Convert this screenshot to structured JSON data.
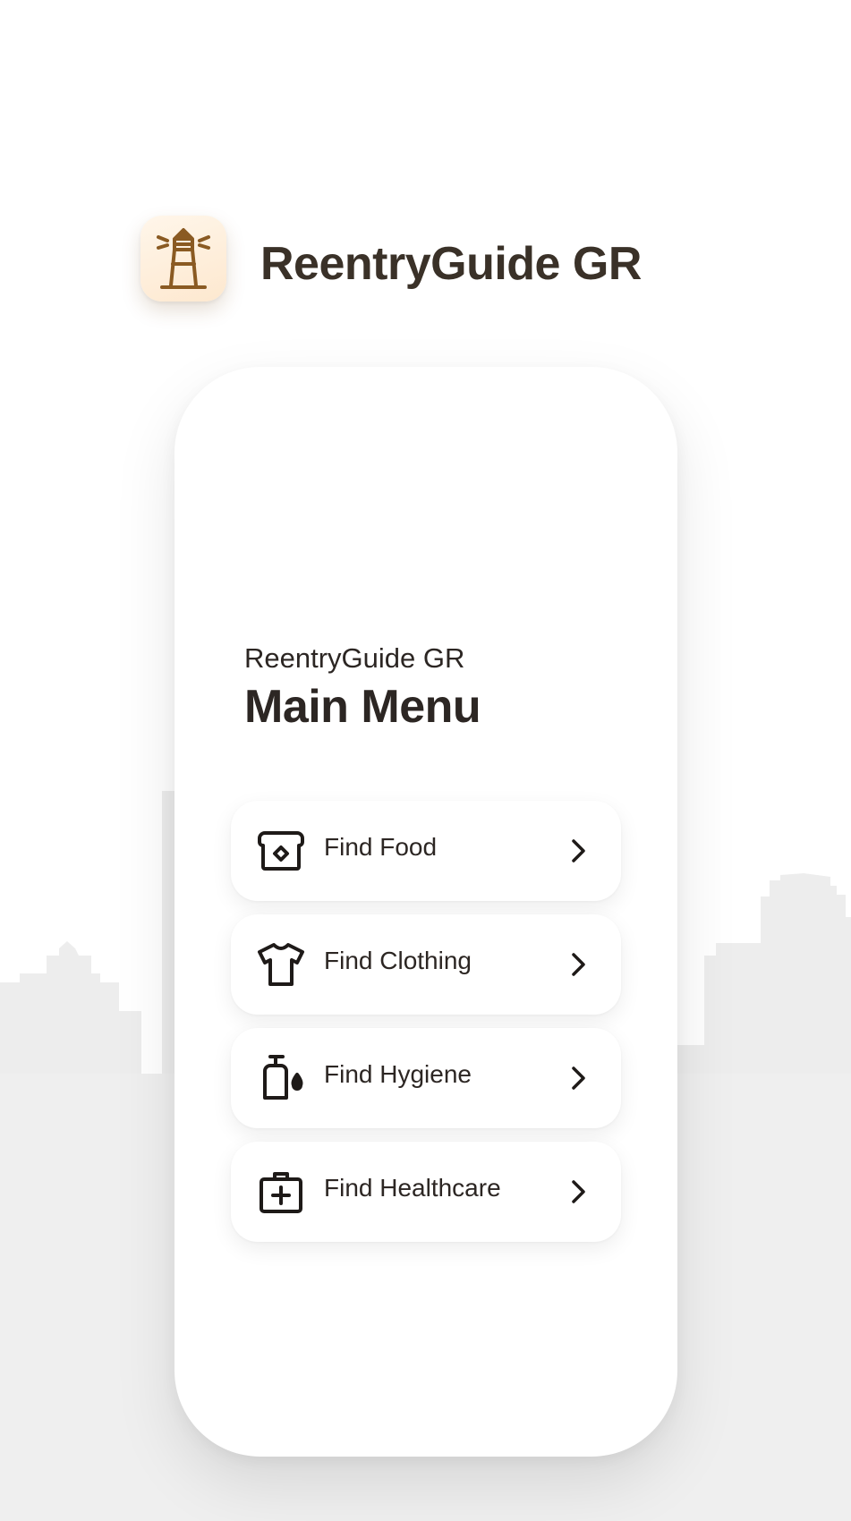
{
  "app": {
    "name": "ReentryGuide GR",
    "icon": "lighthouse-icon",
    "accent_color": "#8a5a22"
  },
  "screen": {
    "subtitle": "ReentryGuide GR",
    "title": "Main Menu"
  },
  "menu": {
    "items": [
      {
        "label": "Find Food",
        "icon": "bread-icon"
      },
      {
        "label": "Find Clothing",
        "icon": "tshirt-icon"
      },
      {
        "label": "Find Hygiene",
        "icon": "soap-dispenser-icon"
      },
      {
        "label": "Find Healthcare",
        "icon": "medical-kit-icon"
      }
    ],
    "chevron_icon": "chevron-right-icon"
  },
  "colors": {
    "text": "#2c2623",
    "background": "#ffffff",
    "skyline": "#eeeeee"
  }
}
